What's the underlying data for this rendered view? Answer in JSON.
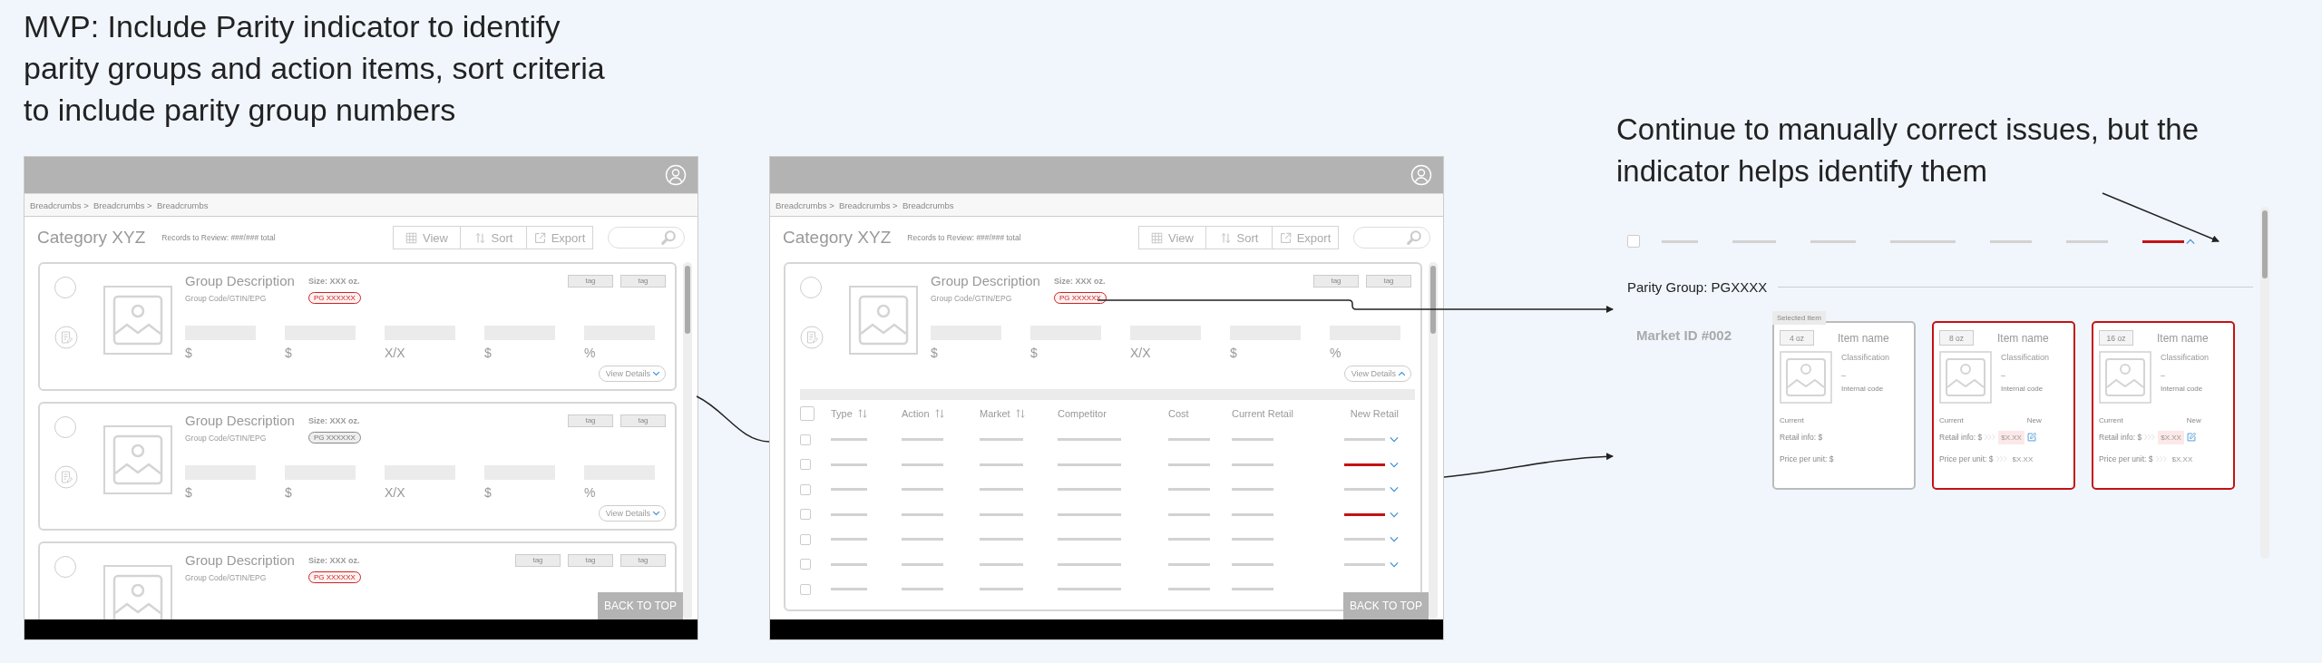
{
  "heading": [
    "MVP: Include Parity indicator to identify",
    "parity groups and action items, sort criteria",
    "to include parity group numbers"
  ],
  "screens": [
    {
      "breadcrumbs": "Breadcrumbs >  Breadcrumbs >  Breadcrumbs",
      "title": "Category XYZ",
      "records": "Records to Review: ###/### total",
      "toolbar": [
        "View",
        "Sort",
        "Export"
      ],
      "cards": [
        {
          "selected": false,
          "title": "Group Description",
          "size": "Size: XXX oz.",
          "code": "Group Code/GTIN/EPG",
          "badge": "PG XXXXXX",
          "flagged": true,
          "tags": [
            "tag",
            "tag"
          ],
          "values": [
            "$",
            "$",
            "X/X",
            "$",
            "%"
          ],
          "details": "View Details",
          "expanded": false
        },
        {
          "selected": false,
          "title": "Group Description",
          "size": "Size: XXX oz.",
          "code": "Group Code/GTIN/EPG",
          "badge": "PG XXXXXX",
          "flagged": false,
          "tags": [
            "tag",
            "tag"
          ],
          "values": [
            "$",
            "$",
            "X/X",
            "$",
            "%"
          ],
          "details": "View Details",
          "expanded": false
        },
        {
          "selected": false,
          "title": "Group Description",
          "size": "Size: XXX oz.",
          "code": "Group Code/GTIN/EPG",
          "badge": "PG XXXXXX",
          "flagged": true,
          "tags": [
            "tag",
            "tag",
            "tag"
          ]
        }
      ],
      "back_to_top": "BACK TO TOP"
    },
    {
      "breadcrumbs": "Breadcrumbs >  Breadcrumbs >  Breadcrumbs",
      "title": "Category XYZ",
      "records": "Records to Review: ###/### total",
      "toolbar": [
        "View",
        "Sort",
        "Export"
      ],
      "cards": [
        {
          "selected": false,
          "title": "Group Description",
          "size": "Size: XXX oz.",
          "code": "Group Code/GTIN/EPG",
          "badge": "PG XXXXXX",
          "flagged": true,
          "tags": [
            "tag",
            "tag"
          ],
          "values": [
            "$",
            "$",
            "X/X",
            "$",
            "%"
          ],
          "details": "View Details",
          "expanded": true,
          "table": {
            "all_checked": false,
            "columns": [
              {
                "label": "Type",
                "sortable": true
              },
              {
                "label": "Action",
                "sortable": true
              },
              {
                "label": "Market",
                "sortable": true
              },
              {
                "label": "Competitor",
                "sortable": false
              },
              {
                "label": "Cost",
                "sortable": false
              },
              {
                "label": "Current Retail",
                "sortable": false
              },
              {
                "label": "New Retail",
                "sortable": false
              }
            ],
            "rows": [
              {
                "checked": false,
                "flagged": false,
                "covered": false
              },
              {
                "checked": false,
                "flagged": true,
                "covered": false
              },
              {
                "checked": false,
                "flagged": false,
                "covered": false
              },
              {
                "checked": false,
                "flagged": true,
                "covered": false
              },
              {
                "checked": false,
                "flagged": false,
                "covered": false
              },
              {
                "checked": false,
                "flagged": false,
                "covered": false
              },
              {
                "checked": false,
                "covered": true
              }
            ]
          }
        }
      ],
      "back_to_top": "BACK TO TOP"
    }
  ],
  "note": [
    "Continue to manually correct issues, but the",
    "indicator helps identify them"
  ],
  "detail": {
    "row": {
      "checked": false,
      "flagged": true,
      "expanded": true
    },
    "parity_group": "Parity Group: PGXXXX",
    "market": "Market ID #002",
    "items": [
      {
        "selected": true,
        "selected_label": "Selected Item",
        "size": "4 oz",
        "name": "Item name",
        "classification": "Classification",
        "dash": "–",
        "code": "Internal code",
        "current": "Current",
        "retail": "Retail info: $",
        "price": "Price per unit: $",
        "flagged": false
      },
      {
        "selected": false,
        "size": "8 oz",
        "name": "Item name",
        "classification": "Classification",
        "dash": "–",
        "code": "Internal code",
        "current": "Current",
        "new": "New",
        "retail": "Retail info: $",
        "new_retail": "$X.XX",
        "price": "Price per unit: $",
        "new_price": "$X.XX",
        "flagged": true
      },
      {
        "selected": false,
        "size": "16 oz",
        "name": "Item name",
        "classification": "Classification",
        "dash": "–",
        "code": "Internal code",
        "current": "Current",
        "new": "New",
        "retail": "Retail info: $",
        "new_retail": "$X.XX",
        "price": "Price per unit: $",
        "new_price": "$X.XX",
        "flagged": true
      }
    ]
  }
}
